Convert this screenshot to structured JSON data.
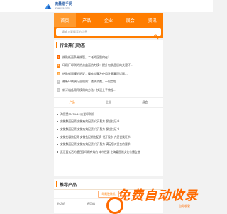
{
  "logo": {
    "name": "流量猎手网",
    "url": "www.xxx.com"
  },
  "nav": {
    "items": [
      "首页",
      "产品",
      "企业",
      "展会",
      "资讯"
    ]
  },
  "search": {
    "placeholder": "请输入要搜索的信息"
  },
  "hot": {
    "title": "行业热门动态",
    "items": [
      "热贴纸面条带热管，二者的区别何在？...",
      "印刷厂印刷的热点盆面热力模：提升包装品质的关键环...",
      "热贴纸面膜的阴证：操作步骤及使用注意事项详解...",
      "最新印刷模行业规则：透明消费，一股工程...",
      "新订机备用开模用的方法：快速上手教程..."
    ]
  },
  "tabs": {
    "items": [
      "产品",
      "企业",
      "展会"
    ],
    "active": 0
  },
  "tab_list": [
    "海德堡SM74-4H大型印刷机",
    "安徽数面配资 安徽有效配资 代开股东 保应找证书",
    "安徽数面配资 安徽有效配资 代开股东 保应找证书",
    "安徽色容数配资 安徽色配期由配资 代开股东 九德优找证书",
    "安徽数面配资 安徽有效配资 代开股东 满足您对资金的要求",
    "武汉西式活的墙日至印刷有效的 本市还要 上海嘉园隆文化传播会造"
  ],
  "products": {
    "title": "推荐产品",
    "tab": "印刷胶装机",
    "links": [
      "分切机",
      "折页机"
    ]
  },
  "watermark": {
    "text": "免费自动收录",
    "sub": "自动收录"
  },
  "colors": {
    "accent": "#ff7d00"
  }
}
